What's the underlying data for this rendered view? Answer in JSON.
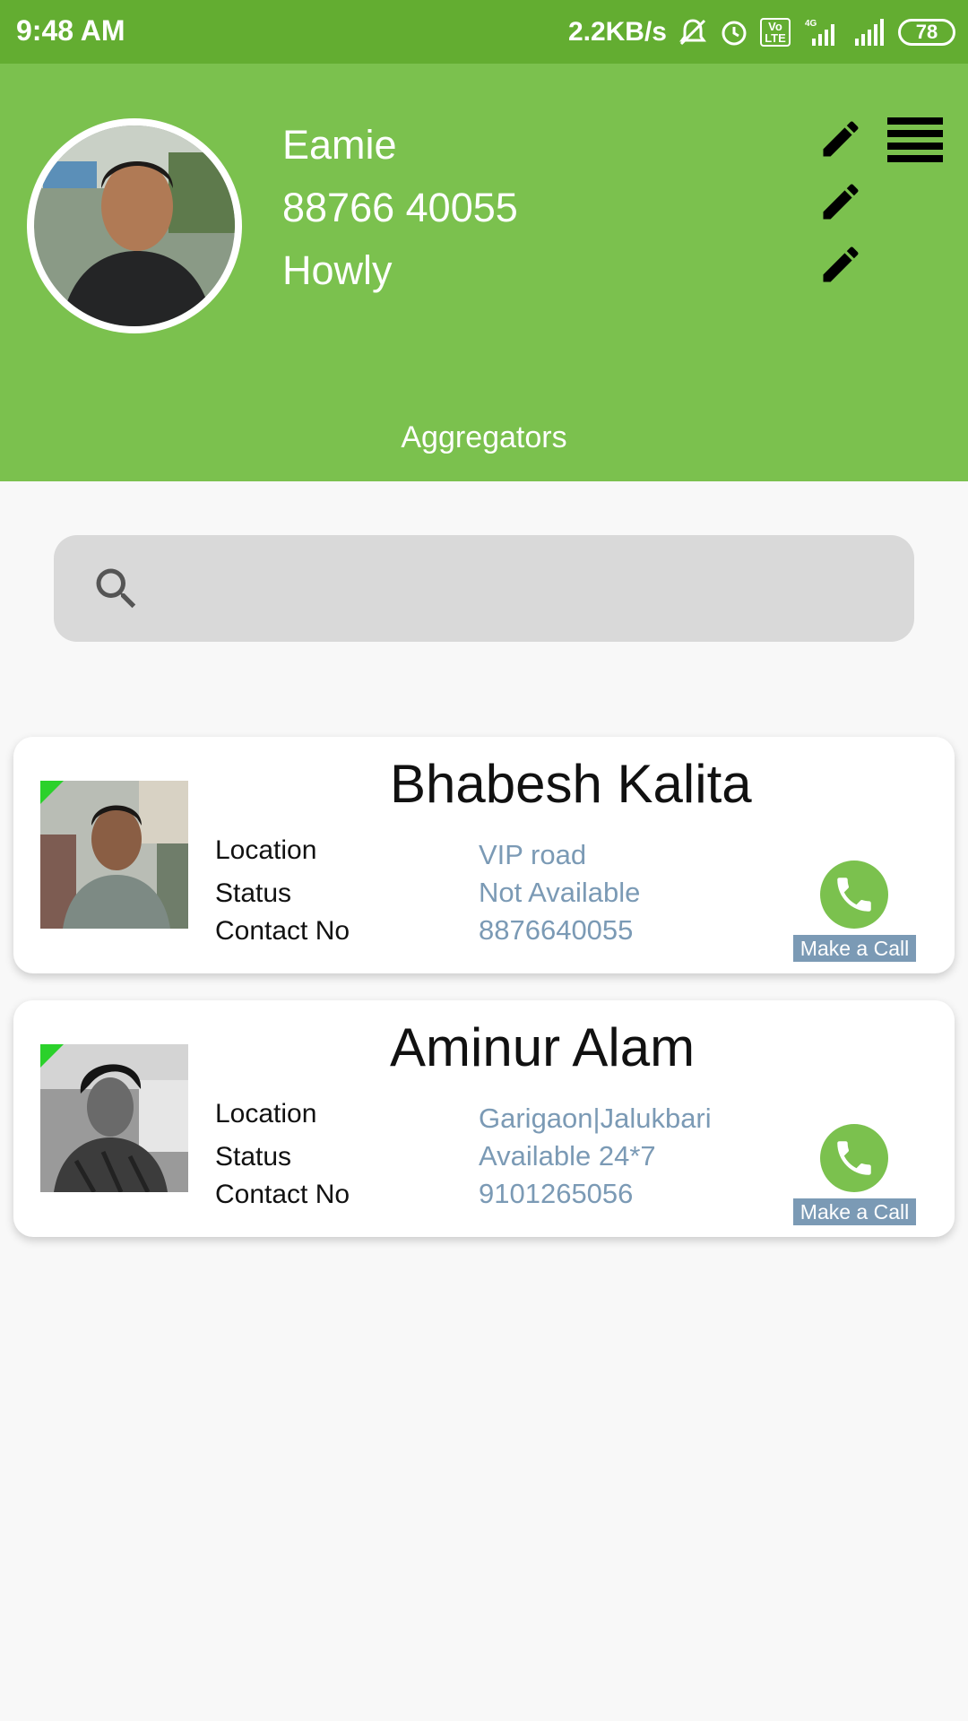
{
  "status_bar": {
    "time": "9:48 AM",
    "speed": "2.2KB/s",
    "battery": "78",
    "volte": "Vo LTE",
    "network": "4G"
  },
  "profile": {
    "name": "Eamie",
    "phone": "88766 40055",
    "city": "Howly"
  },
  "header": {
    "title": "Aggregators"
  },
  "search": {
    "placeholder": "",
    "value": ""
  },
  "cards": [
    {
      "name": "Bhabesh Kalita",
      "location_label": "Location",
      "status_label": "Status",
      "contact_label": "Contact No",
      "location": "VIP road",
      "status": "Not Available",
      "contact": "8876640055",
      "call_label": "Make a Call"
    },
    {
      "name": "Aminur Alam",
      "location_label": "Location",
      "status_label": "Status",
      "contact_label": "Contact No",
      "location": "Garigaon|Jalukbari",
      "status": "Available 24*7",
      "contact": "9101265056",
      "call_label": "Make a Call"
    }
  ],
  "colors": {
    "status_bar": "#63ad31",
    "header": "#7bc14e",
    "accent_value": "#7b9ab5",
    "online_flag": "#2bd12b"
  }
}
